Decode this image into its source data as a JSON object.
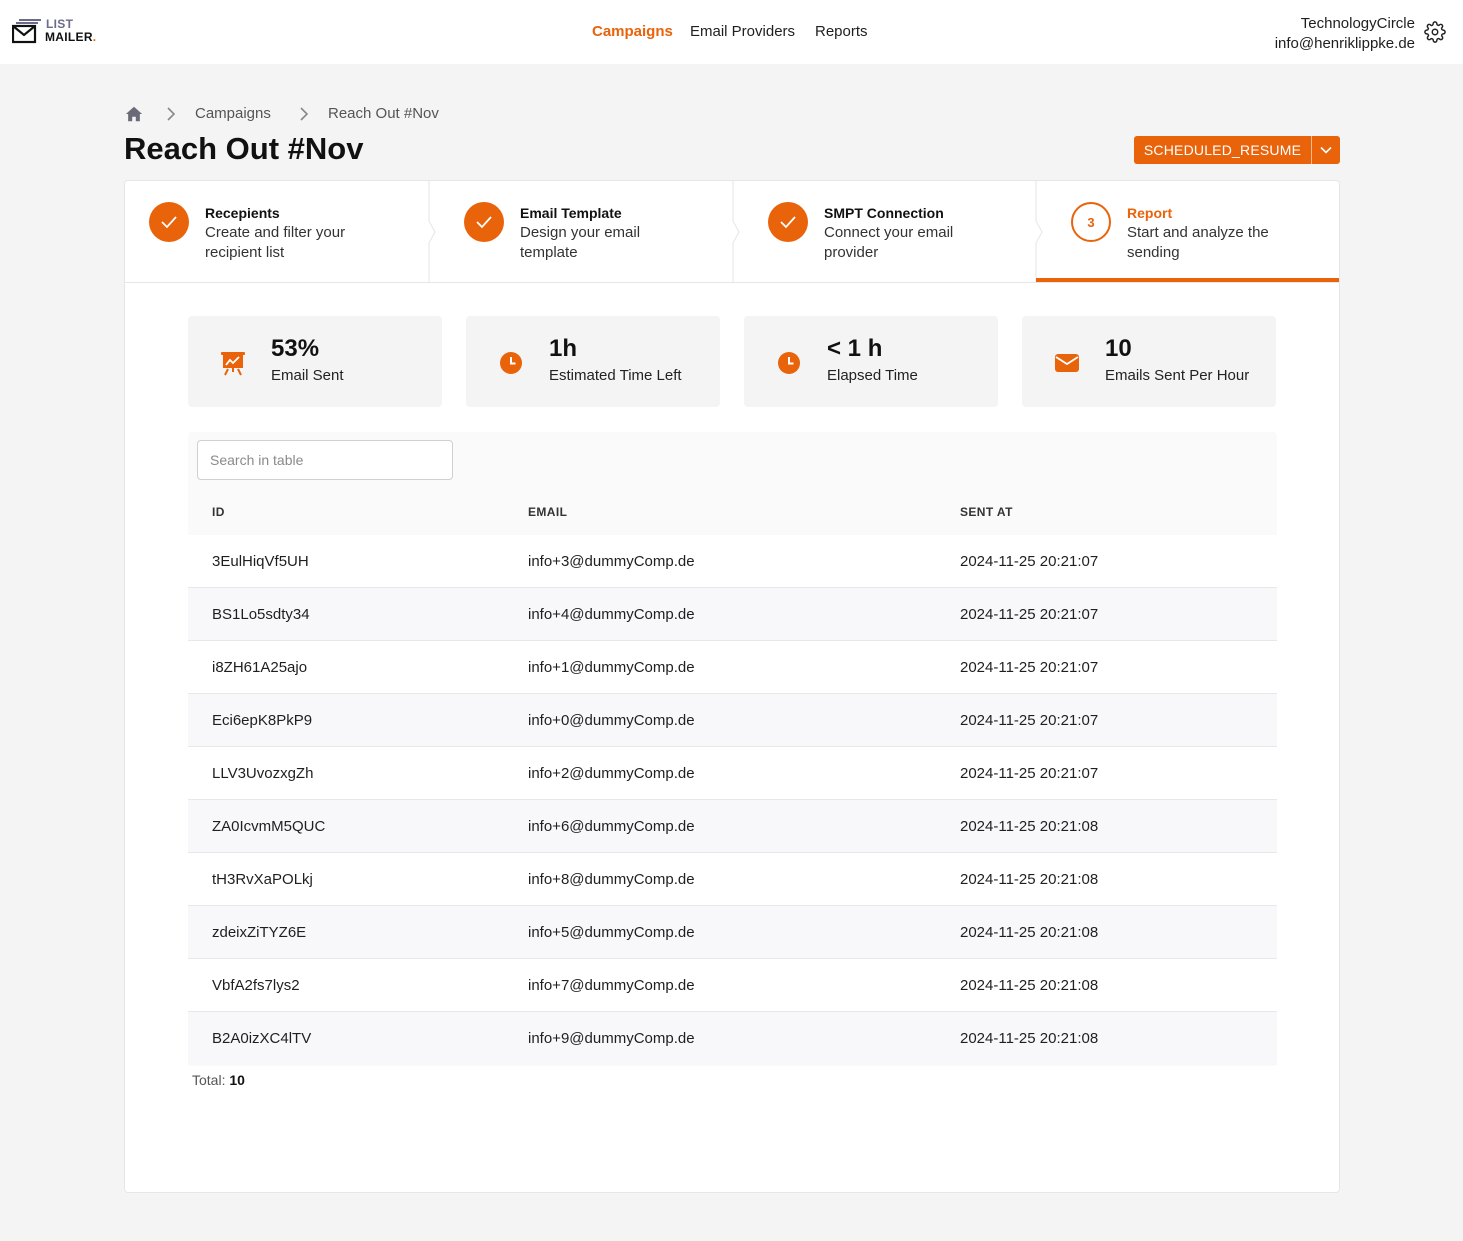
{
  "logo": {
    "line1": "LIST",
    "line2": "MAILER",
    "dot": "."
  },
  "nav": {
    "campaigns": "Campaigns",
    "email_providers": "Email Providers",
    "reports": "Reports"
  },
  "user": {
    "org": "TechnologyCircle",
    "email": "info@henriklippke.de"
  },
  "breadcrumb": {
    "campaigns": "Campaigns",
    "current": "Reach Out #Nov"
  },
  "page": {
    "title": "Reach Out #Nov",
    "status": "SCHEDULED_RESUME"
  },
  "steps": [
    {
      "title": "Recepients",
      "desc": "Create and filter your recipient list"
    },
    {
      "title": "Email Template",
      "desc": "Design your email template"
    },
    {
      "title": "SMPT Connection",
      "desc": "Connect your email provider"
    },
    {
      "number": "3",
      "title": "Report",
      "desc": "Start and analyze the sending"
    }
  ],
  "stats": [
    {
      "icon": "presentation-chart-icon",
      "value": "53%",
      "label": "Email Sent"
    },
    {
      "icon": "clock-icon",
      "value": "1h",
      "label": "Estimated Time Left"
    },
    {
      "icon": "clock-icon",
      "value": "< 1 h",
      "label": "Elapsed Time"
    },
    {
      "icon": "envelope-icon",
      "value": "10",
      "label": "Emails Sent Per Hour"
    }
  ],
  "table": {
    "search_placeholder": "Search in table",
    "headers": {
      "id": "ID",
      "email": "EMAIL",
      "sent_at": "SENT AT"
    },
    "rows": [
      {
        "id": "3EulHiqVf5UH",
        "email": "info+3@dummyComp.de",
        "sent_at": "2024-11-25 20:21:07"
      },
      {
        "id": "BS1Lo5sdty34",
        "email": "info+4@dummyComp.de",
        "sent_at": "2024-11-25 20:21:07"
      },
      {
        "id": "i8ZH61A25ajo",
        "email": "info+1@dummyComp.de",
        "sent_at": "2024-11-25 20:21:07"
      },
      {
        "id": "Eci6epK8PkP9",
        "email": "info+0@dummyComp.de",
        "sent_at": "2024-11-25 20:21:07"
      },
      {
        "id": "LLV3UvozxgZh",
        "email": "info+2@dummyComp.de",
        "sent_at": "2024-11-25 20:21:07"
      },
      {
        "id": "ZA0IcvmM5QUC",
        "email": "info+6@dummyComp.de",
        "sent_at": "2024-11-25 20:21:08"
      },
      {
        "id": "tH3RvXaPOLkj",
        "email": "info+8@dummyComp.de",
        "sent_at": "2024-11-25 20:21:08"
      },
      {
        "id": "zdeixZiTYZ6E",
        "email": "info+5@dummyComp.de",
        "sent_at": "2024-11-25 20:21:08"
      },
      {
        "id": "VbfA2fs7lys2",
        "email": "info+7@dummyComp.de",
        "sent_at": "2024-11-25 20:21:08"
      },
      {
        "id": "B2A0izXC4lTV",
        "email": "info+9@dummyComp.de",
        "sent_at": "2024-11-25 20:21:08"
      }
    ],
    "total_label": "Total:",
    "total_value": "10"
  },
  "colors": {
    "accent": "#e8630a"
  }
}
